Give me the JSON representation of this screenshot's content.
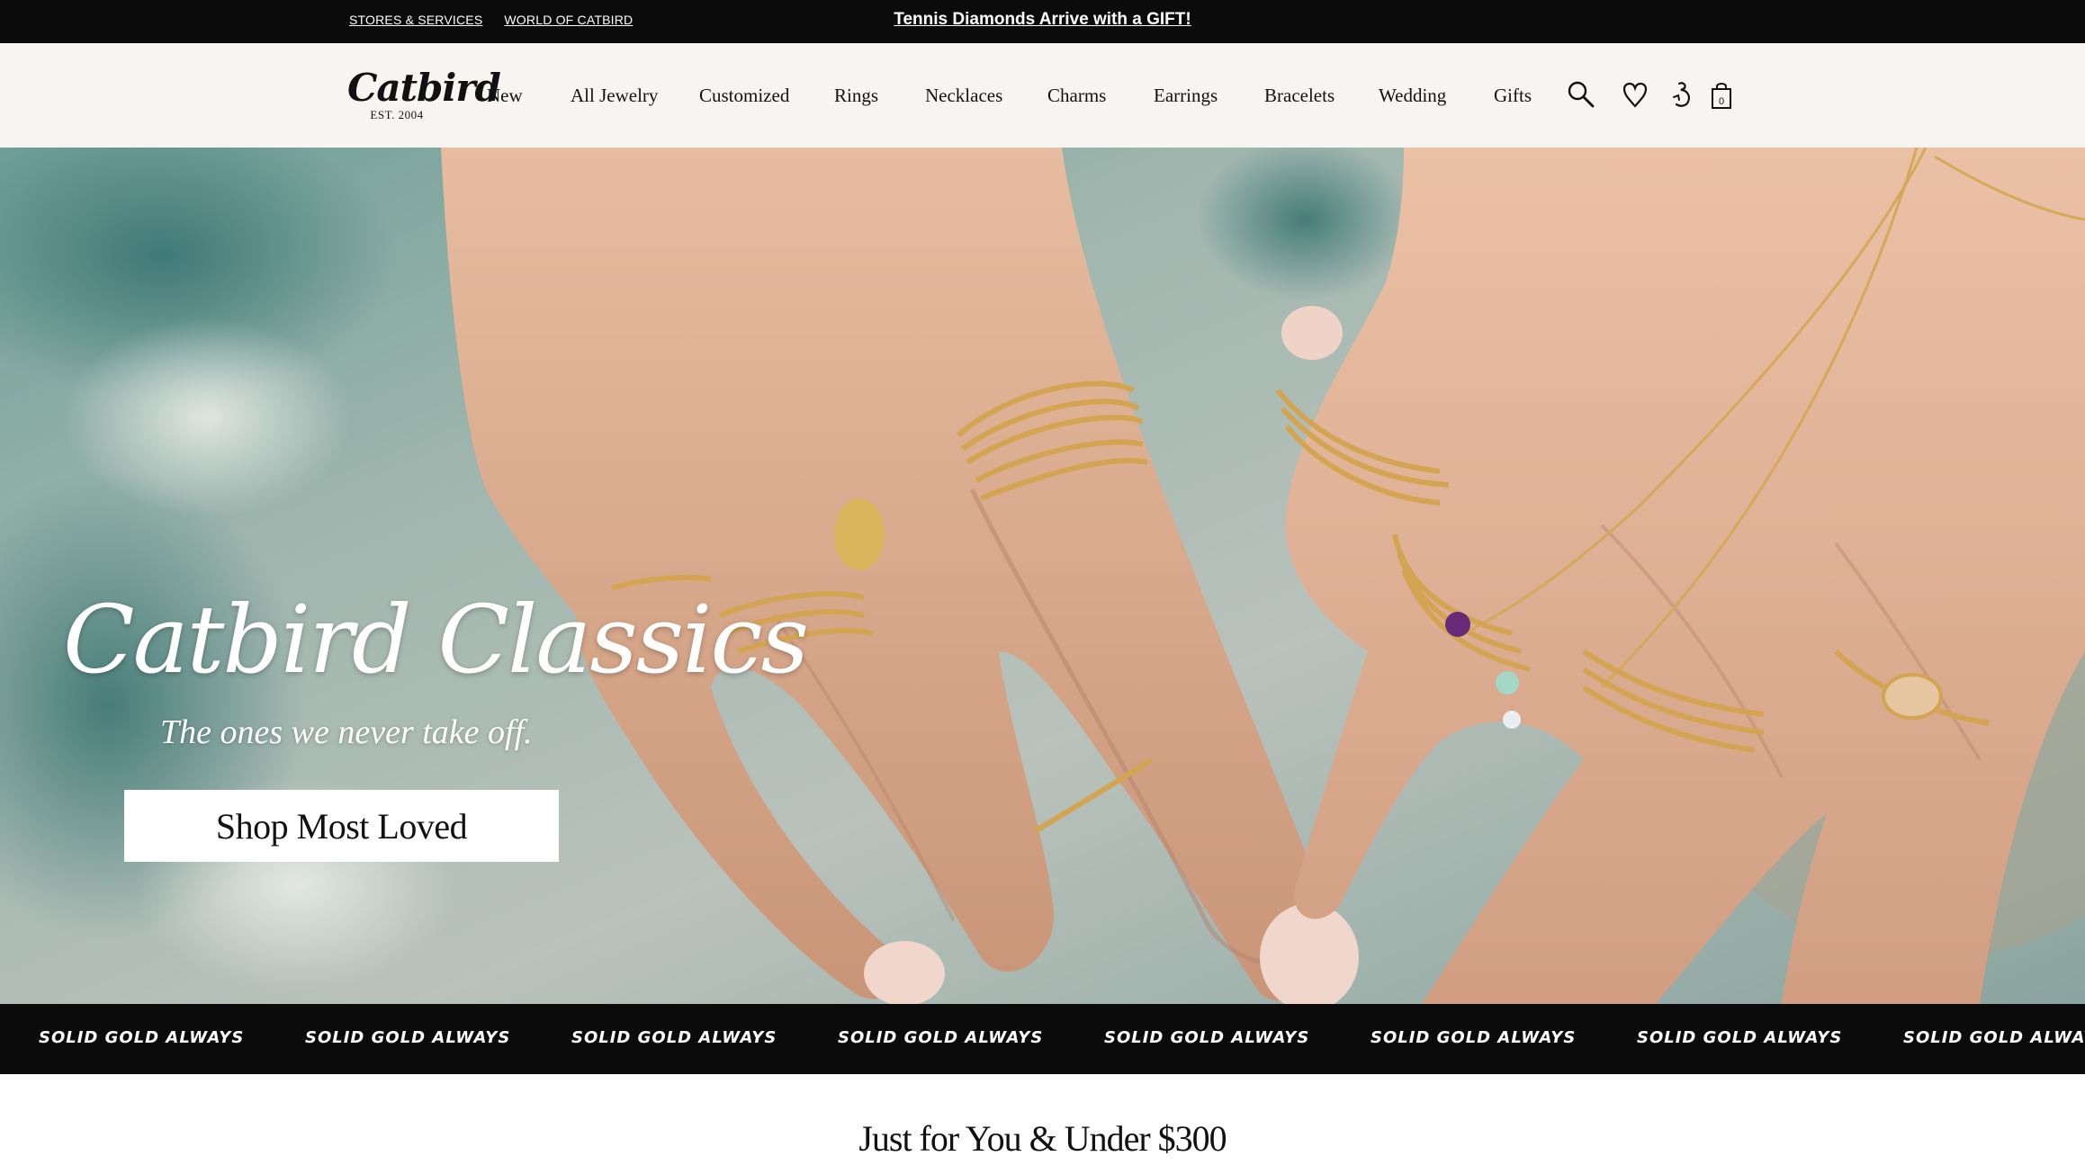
{
  "topbar": {
    "links": [
      "STORES & SERVICES",
      "WORLD OF CATBIRD"
    ],
    "promo": "Tennis Diamonds Arrive with a GIFT!"
  },
  "brand": {
    "name": "Catbird",
    "est": "EST. 2004"
  },
  "nav": {
    "items": [
      "New",
      "All Jewelry",
      "Customized",
      "Rings",
      "Necklaces",
      "Charms",
      "Earrings",
      "Bracelets",
      "Wedding",
      "Gifts"
    ]
  },
  "icons": [
    "search-icon",
    "wishlist-heart-icon",
    "account-icon",
    "shopping-bag-icon"
  ],
  "cart": {
    "count": "0"
  },
  "hero": {
    "title": "Catbird Classics",
    "subtitle": "The ones we never take off.",
    "cta": "Shop Most Loved"
  },
  "marquee": {
    "text": "SOLID GOLD ALWAYS"
  },
  "section": {
    "title": "Just for You & Under $300"
  },
  "colors": {
    "bar": "#0b0b0b",
    "header_bg": "#f6f5f1",
    "gold": "#d3a552",
    "skin": "#e2b497"
  }
}
